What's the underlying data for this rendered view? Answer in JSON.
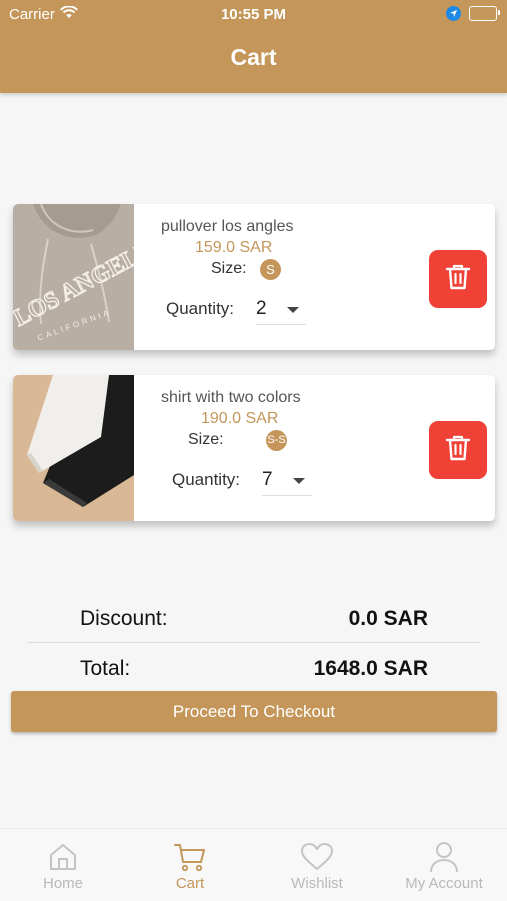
{
  "status_bar": {
    "carrier": "Carrier",
    "time": "10:55 PM"
  },
  "header": {
    "title": "Cart"
  },
  "items": [
    {
      "name": "pullover los angles",
      "price": "159.0 SAR",
      "size_label": "Size:",
      "size_value": "S",
      "quantity_label": "Quantity:",
      "quantity": "2",
      "image_text": "LOS ANGELES"
    },
    {
      "name": "shirt with two colors",
      "price": "190.0 SAR",
      "size_label": "Size:",
      "size_value": "S-S",
      "quantity_label": "Quantity:",
      "quantity": "7"
    }
  ],
  "summary": {
    "discount_label": "Discount:",
    "discount_value": "0.0 SAR",
    "total_label": "Total:",
    "total_value": "1648.0 SAR"
  },
  "checkout_button": "Proceed To Checkout",
  "nav": [
    {
      "label": "Home",
      "icon": "home-icon",
      "active": false
    },
    {
      "label": "Cart",
      "icon": "cart-icon",
      "active": true
    },
    {
      "label": "Wishlist",
      "icon": "heart-icon",
      "active": false
    },
    {
      "label": "My Account",
      "icon": "person-icon",
      "active": false
    }
  ],
  "colors": {
    "brand": "#c4965a",
    "delete": "#ef4136",
    "inactive": "#b9b9b9"
  }
}
